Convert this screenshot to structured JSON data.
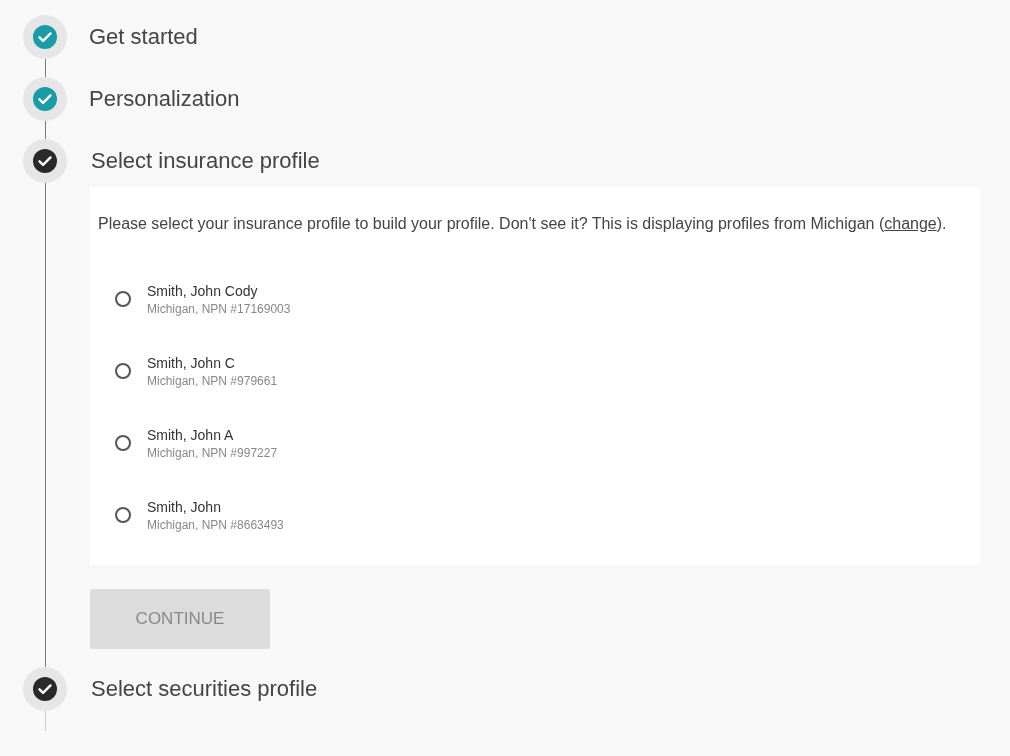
{
  "steps": [
    {
      "title": "Get started",
      "completed": true
    },
    {
      "title": "Personalization",
      "completed": true
    },
    {
      "title": "Select insurance profile",
      "completed": false,
      "panel": {
        "intro": "Please select your insurance profile to build your profile. Don't see it? This is displaying profiles from Michigan (",
        "link": "change",
        "intro_end": ").",
        "options": [
          {
            "name": "Smith, John Cody",
            "detail": "Michigan, NPN #17169003",
            "selected": false
          },
          {
            "name": "Smith, John C",
            "detail": "Michigan, NPN #979661",
            "selected": false
          },
          {
            "name": "Smith, John A",
            "detail": "Michigan, NPN #997227",
            "selected": false
          },
          {
            "name": "Smith, John",
            "detail": "Michigan, NPN #8663493",
            "selected": false
          }
        ],
        "button": {
          "label": "CONTINUE",
          "disabled": true
        }
      }
    },
    {
      "title": "Select securities profile",
      "completed": false
    }
  ]
}
